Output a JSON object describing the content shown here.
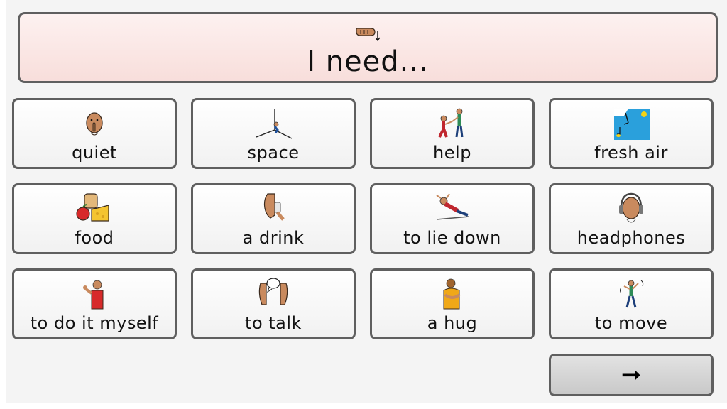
{
  "header": {
    "title": "I need...",
    "icon": "pointing-hand-icon"
  },
  "tiles": [
    {
      "label": "quiet",
      "icon": "quiet-icon"
    },
    {
      "label": "space",
      "icon": "space-icon"
    },
    {
      "label": "help",
      "icon": "help-icon"
    },
    {
      "label": "fresh air",
      "icon": "fresh-air-icon"
    },
    {
      "label": "food",
      "icon": "food-icon"
    },
    {
      "label": "a drink",
      "icon": "drink-icon"
    },
    {
      "label": "to lie down",
      "icon": "lie-down-icon"
    },
    {
      "label": "headphones",
      "icon": "headphones-icon"
    },
    {
      "label": "to do it myself",
      "icon": "do-it-myself-icon"
    },
    {
      "label": "to talk",
      "icon": "talk-icon"
    },
    {
      "label": "a hug",
      "icon": "hug-icon"
    },
    {
      "label": "to move",
      "icon": "move-icon"
    }
  ],
  "next_button": {
    "symbol": "➞",
    "icon": "right-arrow-icon"
  },
  "colors": {
    "header_bg": "#f8dedb",
    "border": "#5f5f5f",
    "skin": "#c98a5e",
    "button_bg": "#d4d4d4"
  }
}
